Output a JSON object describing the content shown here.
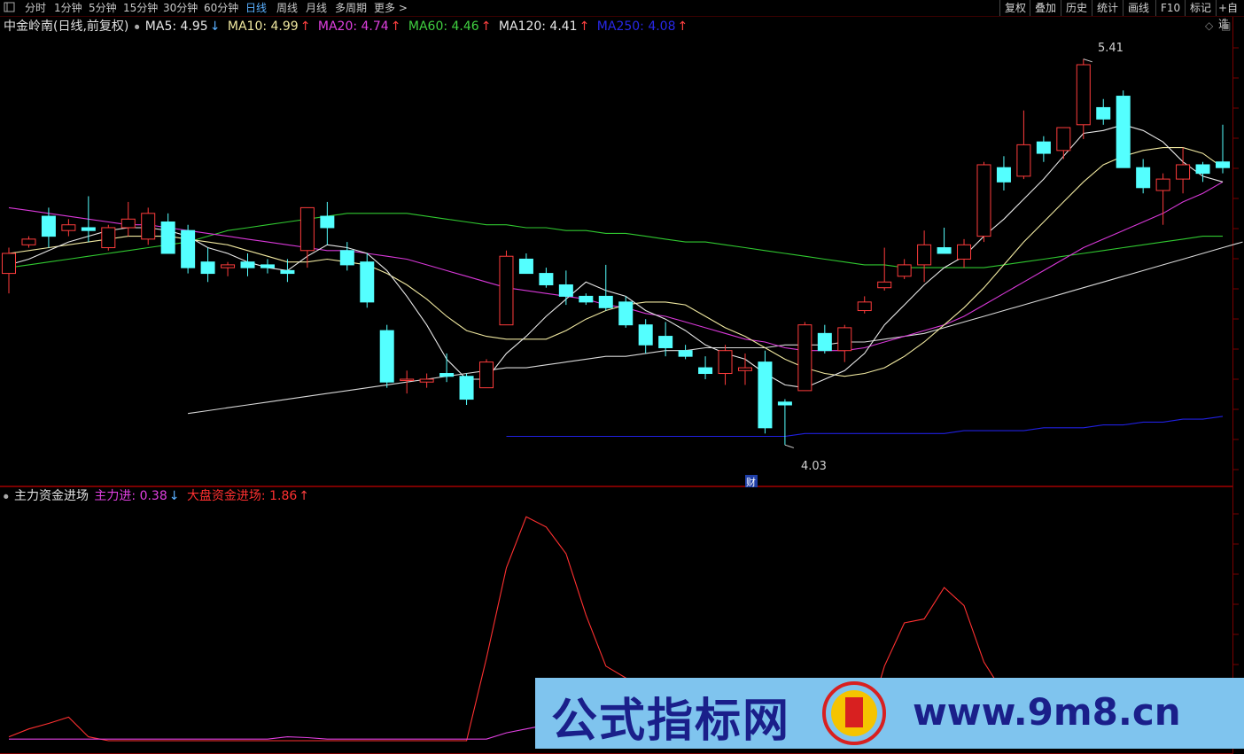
{
  "toolbar": {
    "left_icon": "panel-icon",
    "periods": [
      "分时",
      "1分钟",
      "5分钟",
      "15分钟",
      "30分钟",
      "60分钟",
      "日线",
      "周线",
      "月线",
      "多周期",
      "更多"
    ],
    "more_arrow": ">",
    "right_buttons": [
      "复权",
      "叠加",
      "历史",
      "统计",
      "画线",
      "F10",
      "标记",
      "+自选"
    ]
  },
  "header": {
    "title": "中金岭南(日线,前复权)",
    "ma": [
      {
        "label": "MA5: 4.95",
        "arrow": "↓",
        "color": "#e8e8e8"
      },
      {
        "label": "MA10: 4.99",
        "arrow": "↑",
        "color": "#f0e8a0"
      },
      {
        "label": "MA20: 4.74",
        "arrow": "↑",
        "color": "#e040e0"
      },
      {
        "label": "MA60: 4.46",
        "arrow": "↑",
        "color": "#40d040"
      },
      {
        "label": "MA120: 4.41",
        "arrow": "↑",
        "color": "#e8e8e8"
      },
      {
        "label": "MA250: 4.08",
        "arrow": "↑",
        "color": "#2828e8"
      }
    ],
    "high_label": "5.41",
    "low_label": "4.03",
    "fin_badge": "财"
  },
  "indicator": {
    "title": "主力资金进场",
    "main": {
      "label": "主力进: 0.38",
      "arrow": "↓",
      "color": "#e040e0"
    },
    "big": {
      "label": "大盘资金进场: 1.86",
      "arrow": "↑",
      "color": "#ff3030"
    }
  },
  "watermark": {
    "cn": "公式指标网",
    "url": "www.9m8.cn"
  },
  "colors": {
    "up": "#ff3c3c",
    "down": "#54ffff",
    "ma60": "#30c830",
    "ma20": "#d838d8",
    "ma250": "#2020e0"
  },
  "chart_data": {
    "type": "candlestick",
    "price_ylim": [
      3.95,
      5.45
    ],
    "candles": [
      [
        4.63,
        4.72,
        4.56,
        4.7
      ],
      [
        4.73,
        4.76,
        4.72,
        4.75
      ],
      [
        4.83,
        4.86,
        4.72,
        4.76
      ],
      [
        4.78,
        4.82,
        4.76,
        4.8
      ],
      [
        4.79,
        4.9,
        4.74,
        4.78
      ],
      [
        4.72,
        4.8,
        4.71,
        4.79
      ],
      [
        4.79,
        4.88,
        4.76,
        4.82
      ],
      [
        4.75,
        4.86,
        4.73,
        4.84
      ],
      [
        4.81,
        4.84,
        4.71,
        4.7
      ],
      [
        4.78,
        4.8,
        4.63,
        4.65
      ],
      [
        4.67,
        4.72,
        4.6,
        4.63
      ],
      [
        4.65,
        4.67,
        4.62,
        4.66
      ],
      [
        4.67,
        4.7,
        4.62,
        4.65
      ],
      [
        4.66,
        4.68,
        4.63,
        4.65
      ],
      [
        4.64,
        4.68,
        4.6,
        4.63
      ],
      [
        4.71,
        4.86,
        4.65,
        4.86
      ],
      [
        4.83,
        4.88,
        4.73,
        4.79
      ],
      [
        4.71,
        4.74,
        4.64,
        4.66
      ],
      [
        4.67,
        4.7,
        4.51,
        4.53
      ],
      [
        4.43,
        4.45,
        4.23,
        4.25
      ],
      [
        4.26,
        4.29,
        4.21,
        4.26
      ],
      [
        4.25,
        4.28,
        4.23,
        4.26
      ],
      [
        4.28,
        4.35,
        4.25,
        4.27
      ],
      [
        4.27,
        4.28,
        4.17,
        4.19
      ],
      [
        4.23,
        4.33,
        4.23,
        4.32
      ],
      [
        4.45,
        4.71,
        4.45,
        4.69
      ],
      [
        4.68,
        4.7,
        4.63,
        4.63
      ],
      [
        4.63,
        4.65,
        4.58,
        4.59
      ],
      [
        4.59,
        4.64,
        4.52,
        4.55
      ],
      [
        4.55,
        4.56,
        4.52,
        4.53
      ],
      [
        4.55,
        4.66,
        4.5,
        4.51
      ],
      [
        4.53,
        4.55,
        4.44,
        4.45
      ],
      [
        4.45,
        4.47,
        4.35,
        4.38
      ],
      [
        4.41,
        4.46,
        4.34,
        4.37
      ],
      [
        4.36,
        4.38,
        4.33,
        4.34
      ],
      [
        4.3,
        4.34,
        4.26,
        4.28
      ],
      [
        4.28,
        4.38,
        4.24,
        4.36
      ],
      [
        4.29,
        4.35,
        4.24,
        4.3
      ],
      [
        4.32,
        4.36,
        4.07,
        4.09
      ],
      [
        4.18,
        4.19,
        4.03,
        4.17
      ],
      [
        4.22,
        4.46,
        4.22,
        4.45
      ],
      [
        4.42,
        4.45,
        4.35,
        4.36
      ],
      [
        4.36,
        4.45,
        4.32,
        4.44
      ],
      [
        4.5,
        4.55,
        4.49,
        4.53
      ],
      [
        4.58,
        4.72,
        4.57,
        4.6
      ],
      [
        4.62,
        4.68,
        4.61,
        4.66
      ],
      [
        4.66,
        4.78,
        4.6,
        4.73
      ],
      [
        4.72,
        4.79,
        4.7,
        4.7
      ],
      [
        4.68,
        4.75,
        4.65,
        4.73
      ],
      [
        4.76,
        5.02,
        4.74,
        5.01
      ],
      [
        5.0,
        5.04,
        4.92,
        4.95
      ],
      [
        4.97,
        5.2,
        4.96,
        5.08
      ],
      [
        5.09,
        5.11,
        5.02,
        5.05
      ],
      [
        5.06,
        5.14,
        5.03,
        5.14
      ],
      [
        5.15,
        5.38,
        5.1,
        5.36
      ],
      [
        5.21,
        5.24,
        5.15,
        5.17
      ],
      [
        5.25,
        5.27,
        5.0,
        5.0
      ],
      [
        5.0,
        5.03,
        4.91,
        4.93
      ],
      [
        4.92,
        4.98,
        4.8,
        4.96
      ],
      [
        4.96,
        5.07,
        4.91,
        5.01
      ],
      [
        5.01,
        5.02,
        4.95,
        4.98
      ],
      [
        5.02,
        5.15,
        4.98,
        5.0
      ]
    ],
    "ma5": [
      4.66,
      4.68,
      4.71,
      4.74,
      4.76,
      4.78,
      4.79,
      4.79,
      4.78,
      4.76,
      4.72,
      4.7,
      4.67,
      4.65,
      4.64,
      4.69,
      4.73,
      4.72,
      4.7,
      4.64,
      4.55,
      4.45,
      4.33,
      4.26,
      4.26,
      4.35,
      4.41,
      4.48,
      4.54,
      4.6,
      4.57,
      4.55,
      4.5,
      4.47,
      4.43,
      4.38,
      4.35,
      4.33,
      4.28,
      4.24,
      4.23,
      4.26,
      4.29,
      4.35,
      4.45,
      4.52,
      4.59,
      4.65,
      4.69,
      4.76,
      4.82,
      4.89,
      4.96,
      5.04,
      5.12,
      5.13,
      5.15,
      5.13,
      5.09,
      5.02,
      4.97,
      4.95
    ],
    "ma10": [
      4.7,
      4.71,
      4.72,
      4.73,
      4.74,
      4.75,
      4.76,
      4.76,
      4.76,
      4.75,
      4.74,
      4.73,
      4.71,
      4.69,
      4.67,
      4.67,
      4.68,
      4.67,
      4.66,
      4.63,
      4.59,
      4.54,
      4.48,
      4.43,
      4.41,
      4.4,
      4.4,
      4.4,
      4.43,
      4.47,
      4.5,
      4.52,
      4.53,
      4.53,
      4.52,
      4.48,
      4.44,
      4.41,
      4.37,
      4.33,
      4.3,
      4.28,
      4.27,
      4.28,
      4.3,
      4.34,
      4.39,
      4.45,
      4.51,
      4.58,
      4.66,
      4.74,
      4.81,
      4.88,
      4.95,
      5.01,
      5.04,
      5.06,
      5.07,
      5.07,
      5.05,
      5.0
    ],
    "ma20": [
      4.86,
      4.85,
      4.84,
      4.83,
      4.82,
      4.81,
      4.8,
      4.8,
      4.79,
      4.78,
      4.77,
      4.76,
      4.75,
      4.74,
      4.73,
      4.72,
      4.71,
      4.71,
      4.7,
      4.69,
      4.68,
      4.66,
      4.64,
      4.62,
      4.6,
      4.58,
      4.57,
      4.56,
      4.55,
      4.54,
      4.52,
      4.51,
      4.49,
      4.48,
      4.46,
      4.44,
      4.42,
      4.4,
      4.39,
      4.37,
      4.36,
      4.36,
      4.36,
      4.37,
      4.39,
      4.41,
      4.43,
      4.45,
      4.48,
      4.52,
      4.56,
      4.6,
      4.64,
      4.68,
      4.72,
      4.75,
      4.78,
      4.81,
      4.84,
      4.88,
      4.91,
      4.95
    ],
    "ma60": [
      4.65,
      4.66,
      4.67,
      4.68,
      4.69,
      4.7,
      4.71,
      4.72,
      4.73,
      4.74,
      4.76,
      4.78,
      4.79,
      4.8,
      4.81,
      4.82,
      4.83,
      4.84,
      4.84,
      4.84,
      4.84,
      4.83,
      4.82,
      4.81,
      4.8,
      4.8,
      4.79,
      4.79,
      4.78,
      4.78,
      4.77,
      4.77,
      4.76,
      4.75,
      4.74,
      4.74,
      4.73,
      4.72,
      4.71,
      4.7,
      4.69,
      4.68,
      4.67,
      4.66,
      4.66,
      4.65,
      4.65,
      4.65,
      4.65,
      4.65,
      4.66,
      4.67,
      4.68,
      4.69,
      4.7,
      4.71,
      4.72,
      4.73,
      4.74,
      4.75,
      4.76,
      4.76
    ],
    "ma120_start_index": 9,
    "ma120": [
      4.14,
      4.15,
      4.16,
      4.17,
      4.18,
      4.19,
      4.2,
      4.21,
      4.22,
      4.23,
      4.24,
      4.25,
      4.26,
      4.27,
      4.28,
      4.29,
      4.3,
      4.3,
      4.31,
      4.32,
      4.33,
      4.34,
      4.34,
      4.35,
      4.36,
      4.36,
      4.37,
      4.37,
      4.37,
      4.37,
      4.38,
      4.38,
      4.38,
      4.39,
      4.39,
      4.4,
      4.41,
      4.42,
      4.44,
      4.46,
      4.48,
      4.5,
      4.52,
      4.54,
      4.56,
      4.58,
      4.6,
      4.62,
      4.64,
      4.66,
      4.68,
      4.7,
      4.72,
      4.74
    ],
    "ma250_start_index": 25,
    "ma250": [
      4.06,
      4.06,
      4.06,
      4.06,
      4.06,
      4.06,
      4.06,
      4.06,
      4.06,
      4.06,
      4.06,
      4.06,
      4.06,
      4.06,
      4.06,
      4.07,
      4.07,
      4.07,
      4.07,
      4.07,
      4.07,
      4.07,
      4.07,
      4.08,
      4.08,
      4.08,
      4.08,
      4.09,
      4.09,
      4.09,
      4.1,
      4.1,
      4.11,
      4.11,
      4.12,
      4.12,
      4.13
    ],
    "ind_ylim": [
      0,
      3.0
    ],
    "big_fund": [
      0.05,
      0.15,
      0.22,
      0.3,
      0.05,
      0,
      0,
      0,
      0,
      0,
      0,
      0,
      0,
      0,
      0,
      0,
      0,
      0,
      0,
      0,
      0,
      0,
      0,
      0,
      1.05,
      2.2,
      2.85,
      2.72,
      2.38,
      1.6,
      0.95,
      0.8,
      0.6,
      0.4,
      0.2,
      0.1,
      0.05,
      0,
      0,
      0,
      0,
      0,
      0,
      0.1,
      0.95,
      1.5,
      1.55,
      1.95,
      1.72,
      1.0,
      0.6,
      0.5,
      0.45,
      0.4,
      0.3,
      0.35,
      0.4,
      0.45,
      0.5,
      0.55,
      0.6,
      0.62
    ],
    "main_fund": [
      0.02,
      0.02,
      0.02,
      0.02,
      0.02,
      0.02,
      0.02,
      0.02,
      0.02,
      0.02,
      0.02,
      0.02,
      0.02,
      0.02,
      0.05,
      0.04,
      0.02,
      0.02,
      0.02,
      0.02,
      0.02,
      0.02,
      0.02,
      0.02,
      0.02,
      0.1,
      0.15,
      0.2,
      0.2,
      0.15,
      0.1,
      0.1,
      0.1,
      0.1,
      0.1,
      0.1,
      0.1,
      0.1,
      0.1,
      0.1,
      0.1,
      0.1,
      0.1,
      0.1,
      0.1,
      0.2,
      0.25,
      0.3,
      0.35,
      0.4,
      0.4,
      0.4,
      0.5,
      0.6,
      0.78,
      0.78,
      0.7,
      0.6,
      0.5,
      0.45,
      0.4,
      0.38
    ]
  }
}
